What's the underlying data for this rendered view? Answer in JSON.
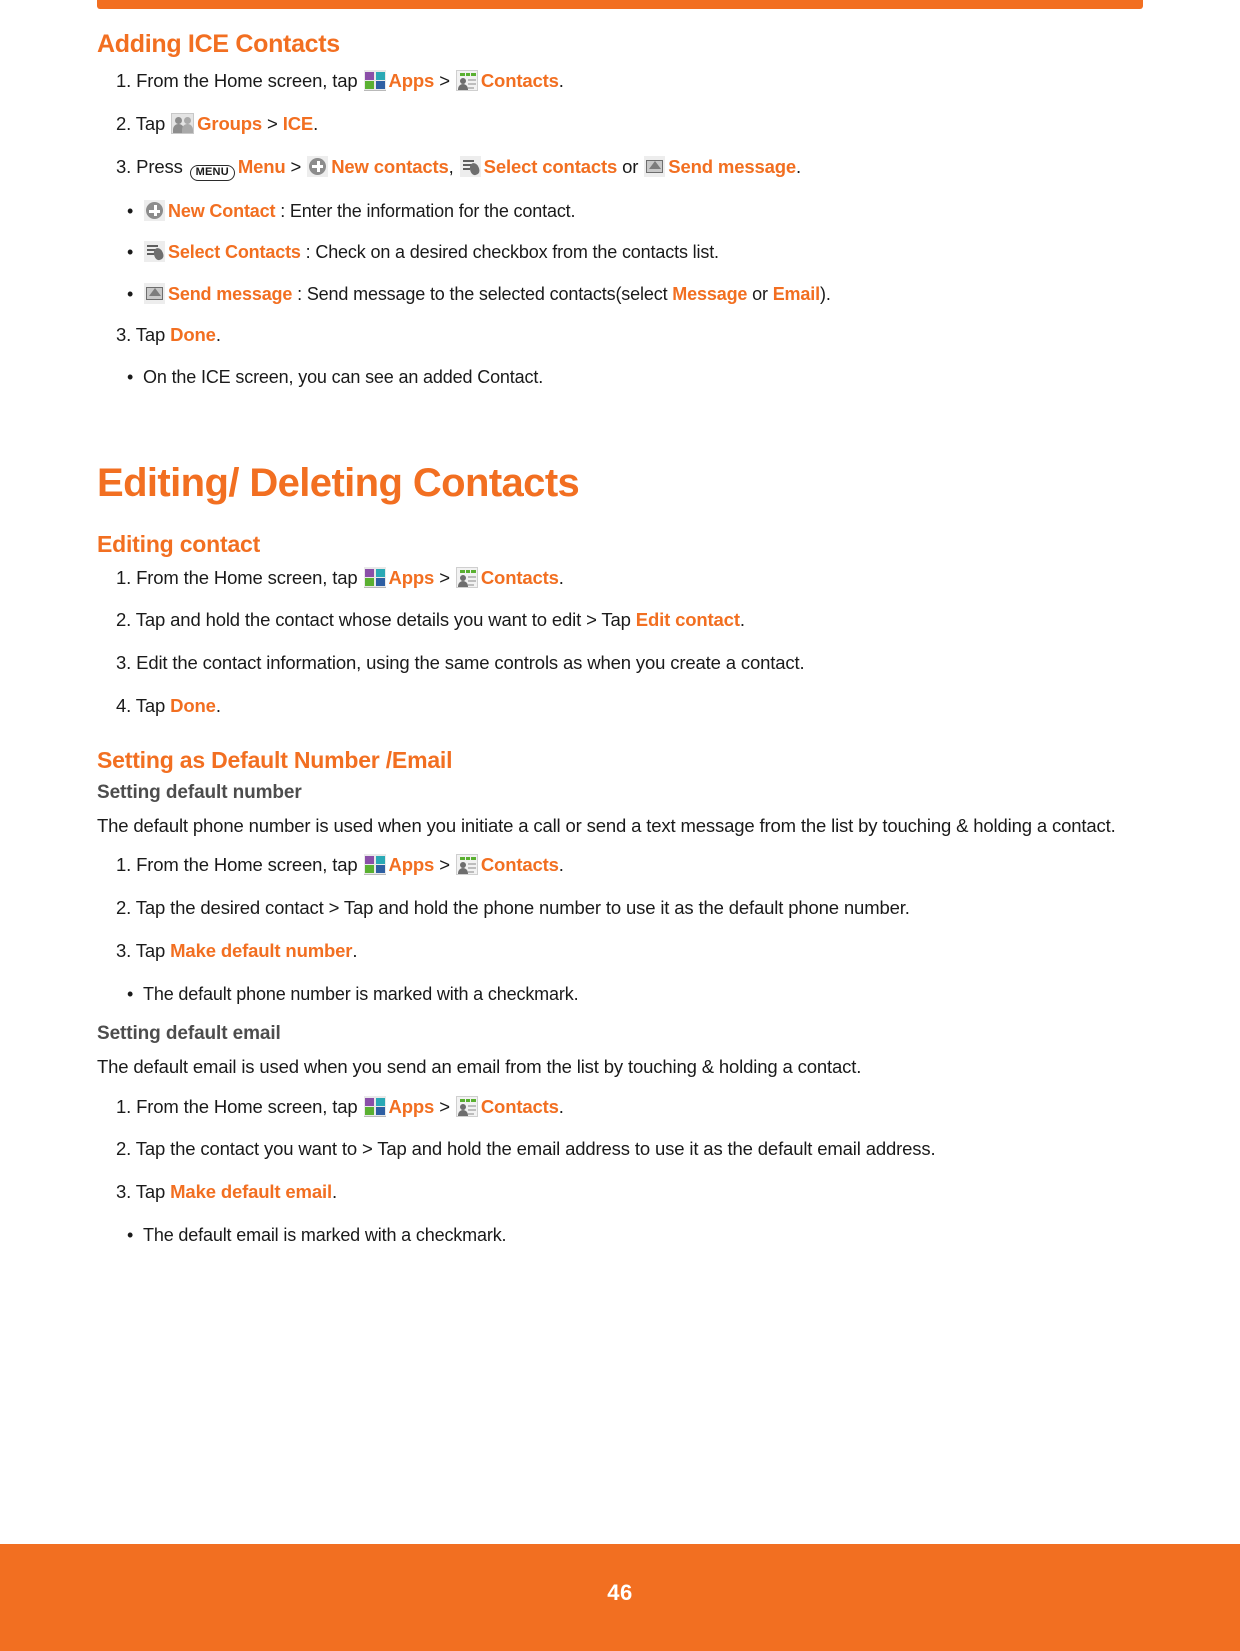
{
  "document": {
    "page_number": "46",
    "accent_color": "#f26f21",
    "text_color": "#1a1a1a",
    "subheading_color": "#4d4d4d"
  },
  "sections": {
    "adding_ice": {
      "title": "Adding ICE Contacts",
      "step1": {
        "num": "1. ",
        "pre": "From the Home screen, tap ",
        "apps_label": "Apps",
        "sep": " > ",
        "contacts_label": "Contacts",
        "end": "."
      },
      "step2": {
        "num": "2. ",
        "pre": "Tap ",
        "groups_label": "Groups",
        "sep": " > ",
        "ice_label": "ICE",
        "end": "."
      },
      "step3": {
        "num": "3. ",
        "pre": "Press ",
        "menu_key": "MENU",
        "menu_label": "Menu",
        "sep": " > ",
        "new_contacts_label": "New contacts",
        "comma": ", ",
        "select_contacts_label": "Select contacts",
        "or_word": " or ",
        "send_message_label": "Send message",
        "end": "."
      },
      "bullet_new_contact": {
        "label": "New Contact",
        "text": " : Enter the information for the contact."
      },
      "bullet_select_contacts": {
        "label": "Select Contacts",
        "text": " : Check on a desired checkbox from the contacts list."
      },
      "bullet_send_message": {
        "label": "Send message",
        "text_a": " : Send message to the selected contacts(select ",
        "message_label": "Message",
        "or_word": " or ",
        "email_label": "Email",
        "text_b": ")."
      },
      "step_done": {
        "num": "3. ",
        "pre": "Tap ",
        "done_label": "Done",
        "end": "."
      },
      "bullet_ice_screen": {
        "text": "On the ICE screen, you can see an added Contact."
      }
    },
    "editing_deleting": {
      "title": "Editing/ Deleting Contacts",
      "editing_contact": {
        "title": "Editing contact",
        "step1": {
          "num": "1. ",
          "pre": "From the Home screen, tap ",
          "apps_label": "Apps",
          "sep": " > ",
          "contacts_label": "Contacts",
          "end": "."
        },
        "step2": {
          "num": "2. ",
          "pre": "Tap and hold the contact whose details you want to edit > Tap ",
          "edit_contact_label": "Edit contact",
          "end": "."
        },
        "step3": {
          "num": "3. ",
          "text": "Edit the contact information, using the same controls as when you create a contact."
        },
        "step4": {
          "num": "4. ",
          "pre": "Tap ",
          "done_label": "Done",
          "end": "."
        }
      },
      "default_number_email": {
        "title": "Setting as Default Number /Email",
        "default_number": {
          "subtitle": "Setting default number",
          "paragraph": "The default phone number is used when you initiate a call or send a text message from the list by touching & holding a contact.",
          "step1": {
            "num": "1. ",
            "pre": "From the Home screen, tap ",
            "apps_label": "Apps",
            "sep": " > ",
            "contacts_label": "Contacts",
            "end": "."
          },
          "step2": {
            "num": "2. ",
            "text": "Tap the desired contact > Tap and hold the phone number to use it as the default phone number."
          },
          "step3": {
            "num": "3. ",
            "pre": "Tap ",
            "make_default_label": "Make default number",
            "end": "."
          },
          "bullet": {
            "text": "The default phone number is marked with a checkmark."
          }
        },
        "default_email": {
          "subtitle": "Setting default email",
          "paragraph": "The default email is used when you send an email from the list by touching & holding a contact.",
          "step1": {
            "num": "1. ",
            "pre": "From the Home screen, tap ",
            "apps_label": "Apps",
            "sep": " > ",
            "contacts_label": "Contacts",
            "end": "."
          },
          "step2": {
            "num": "2. ",
            "text": "Tap the contact you want to > Tap and hold the email address to use it as the default email address."
          },
          "step3": {
            "num": "3. ",
            "pre": "Tap ",
            "make_default_label": "Make default email",
            "end": "."
          },
          "bullet": {
            "text": "The default email is marked with a checkmark."
          }
        }
      }
    }
  },
  "icons": {
    "apps": "apps-grid-icon",
    "contacts": "contacts-card-icon",
    "groups": "groups-people-icon",
    "menu_key": "menu-hardkey-icon",
    "new_contact": "plus-circle-icon",
    "select_contacts": "select-list-icon",
    "send_message": "envelope-icon",
    "bullet": "bullet-dot-icon"
  }
}
